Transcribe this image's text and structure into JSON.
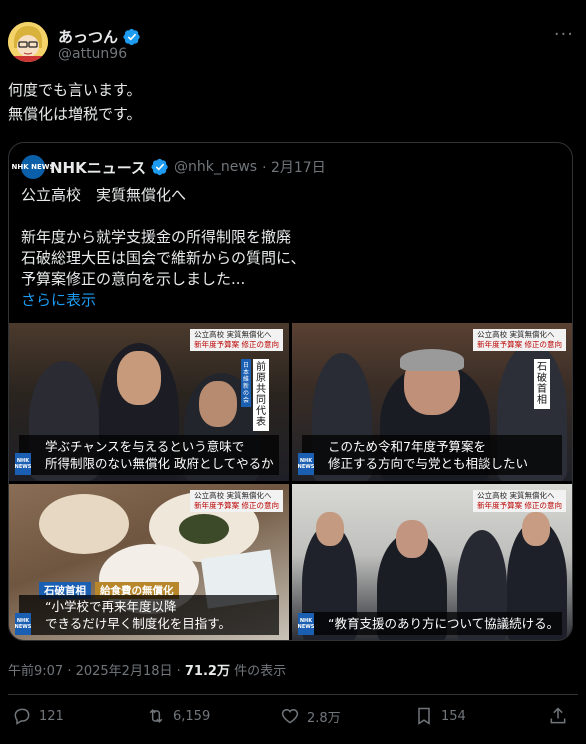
{
  "tweet": {
    "display_name": "あっつん",
    "handle": "@attun96",
    "more_icon": "more-icon",
    "text_lines": [
      "何度でも言います。",
      "無償化は増税です。"
    ],
    "timestamp": "午前9:07 · 2025年2月18日 · ",
    "views_count": "71.2万",
    "views_label": " 件の表示"
  },
  "quote": {
    "display_name": "NHKニュース",
    "handle": "@nhk_news",
    "date": "· 2月17日",
    "avatar_text": "NHK NEWS",
    "text_lines": [
      "公立高校　実質無償化へ",
      "",
      "新年度から就学支援金の所得制限を撤廃",
      "石破総理大臣は国会で維新からの質問に、",
      "予算案修正の意向を示しました..."
    ],
    "show_more": "さらに表示"
  },
  "media": [
    {
      "top_label_1": "公立高校 実質無償化へ",
      "top_label_2": "新年度予算案 修正の意向",
      "side_label": "前原共同代表",
      "side_label_small": "日本維新の会",
      "caption_lines": [
        "学ぶチャンスを与えるという意味で",
        "所得制限のない無償化 政府としてやるか"
      ],
      "badge": "NHK NEWS"
    },
    {
      "top_label_1": "公立高校 実質無償化へ",
      "top_label_2": "新年度予算案 修正の意向",
      "side_label": "石破首相",
      "caption_lines": [
        "このため令和7年度予算案を",
        "修正する方向で与党とも相談したい"
      ],
      "badge": "NHK NEWS"
    },
    {
      "top_label_1": "公立高校 実質無償化へ",
      "top_label_2": "新年度予算案 修正の意向",
      "tag_person": "石破首相",
      "tag_topic": "給食費の無償化",
      "caption_lines": [
        "“小学校で再来年度以降",
        "できるだけ早く制度化を目指す。"
      ],
      "badge": "NHK NEWS"
    },
    {
      "top_label_1": "公立高校 実質無償化へ",
      "top_label_2": "新年度予算案 修正の意向",
      "caption_lines": [
        "“教育支援のあり方について協議続ける。"
      ],
      "badge": "NHK NEWS"
    }
  ],
  "actions": {
    "reply_count": "121",
    "retweet_count": "6,159",
    "like_count": "2.8万",
    "bookmark_count": "154"
  },
  "colors": {
    "background": "#000000",
    "text": "#e7e9ea",
    "muted": "#71767b",
    "link": "#1d9bf0",
    "verified": "#1d9bf0",
    "border": "#2f3336"
  }
}
